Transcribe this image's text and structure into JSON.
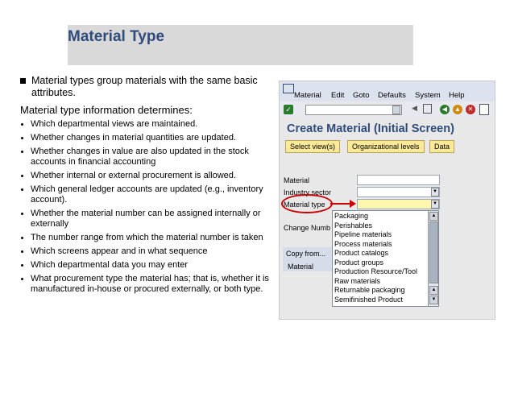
{
  "slide": {
    "title": "Material Type",
    "intro": "Material types group materials with the same basic attributes.",
    "lead": "Material type information determines:",
    "bullets": [
      "Which departmental views are maintained.",
      "Whether changes in material quantities are updated.",
      "Whether changes in value are also updated in the stock accounts in financial accounting",
      "Whether internal or external procurement is allowed.",
      "Which general ledger accounts are updated   (e.g., inventory account).",
      "Whether the material number can be assigned internally or externally",
      "The number range from which the material number is taken",
      "Which screens appear and in what sequence",
      "Which departmental data you may enter",
      "What procurement type the material has; that is, whether it is manufactured in-house or procured externally, or both type."
    ]
  },
  "sap": {
    "menu": [
      "Material",
      "Edit",
      "Goto",
      "Defaults",
      "System",
      "Help"
    ],
    "screen_title": "Create Material (Initial Screen)",
    "buttons": [
      "Select view(s)",
      "Organizational levels",
      "Data"
    ],
    "fields": {
      "material_label": "Material",
      "industry_label": "Industry sector",
      "type_label": "Material type",
      "change_label": "Change Numb"
    },
    "copy": {
      "button": "Copy from...",
      "row": "Material"
    },
    "dropdown_options": [
      "Packaging",
      "Perishables",
      "Pipeline materials",
      "Process materials",
      "Product catalogs",
      "Product groups",
      "Production Resource/Tool",
      "Raw materials",
      "Returnable packaging",
      "Semifinished Product"
    ],
    "colors": {
      "accent": "#2f4b7c",
      "highlight": "#cc0000",
      "button": "#fbe99a"
    }
  }
}
